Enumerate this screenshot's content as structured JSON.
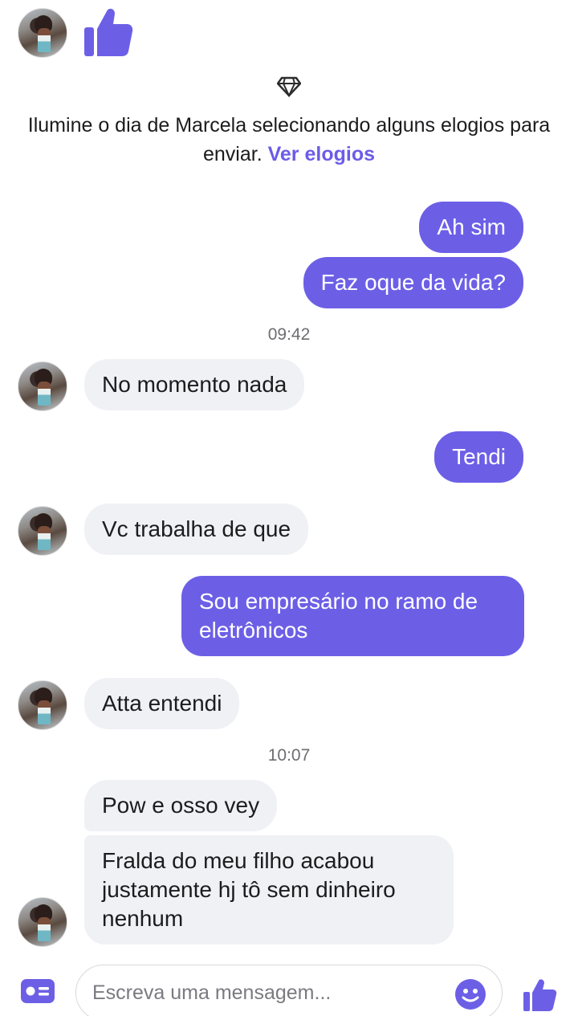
{
  "header": {
    "avatar_icon": "contact-avatar",
    "like_icon": "thumbs-up-icon"
  },
  "intro": {
    "icon": "diamond-icon",
    "text": "Ilumine o dia de Marcela selecionando alguns elogios para enviar.",
    "link": "Ver elogios"
  },
  "messages": [
    {
      "from": "me",
      "text": "Ah sim"
    },
    {
      "from": "me",
      "text": "Faz oque da vida?"
    },
    {
      "type": "time",
      "text": "09:42"
    },
    {
      "from": "contact",
      "text": "No momento nada"
    },
    {
      "from": "me",
      "text": "Tendi"
    },
    {
      "from": "contact",
      "text": "Vc trabalha de que"
    },
    {
      "from": "me",
      "text": "Sou empresário no ramo de eletrônicos"
    },
    {
      "from": "contact",
      "text": "Atta entendi"
    },
    {
      "type": "time",
      "text": "10:07"
    },
    {
      "from": "contact",
      "text": "Pow e osso vey"
    },
    {
      "from": "contact",
      "text": "Fralda do meu filho acabou justamente hj tô sem dinheiro nenhum"
    }
  ],
  "composer": {
    "placeholder": "Escreva uma mensagem...",
    "left_icon": "id-card-icon",
    "emoji_icon": "smiley-icon",
    "send_icon": "thumbs-up-icon"
  },
  "colors": {
    "accent": "#6c5fe6",
    "incoming_bubble": "#f0f1f5",
    "outgoing_text": "#ffffff"
  }
}
